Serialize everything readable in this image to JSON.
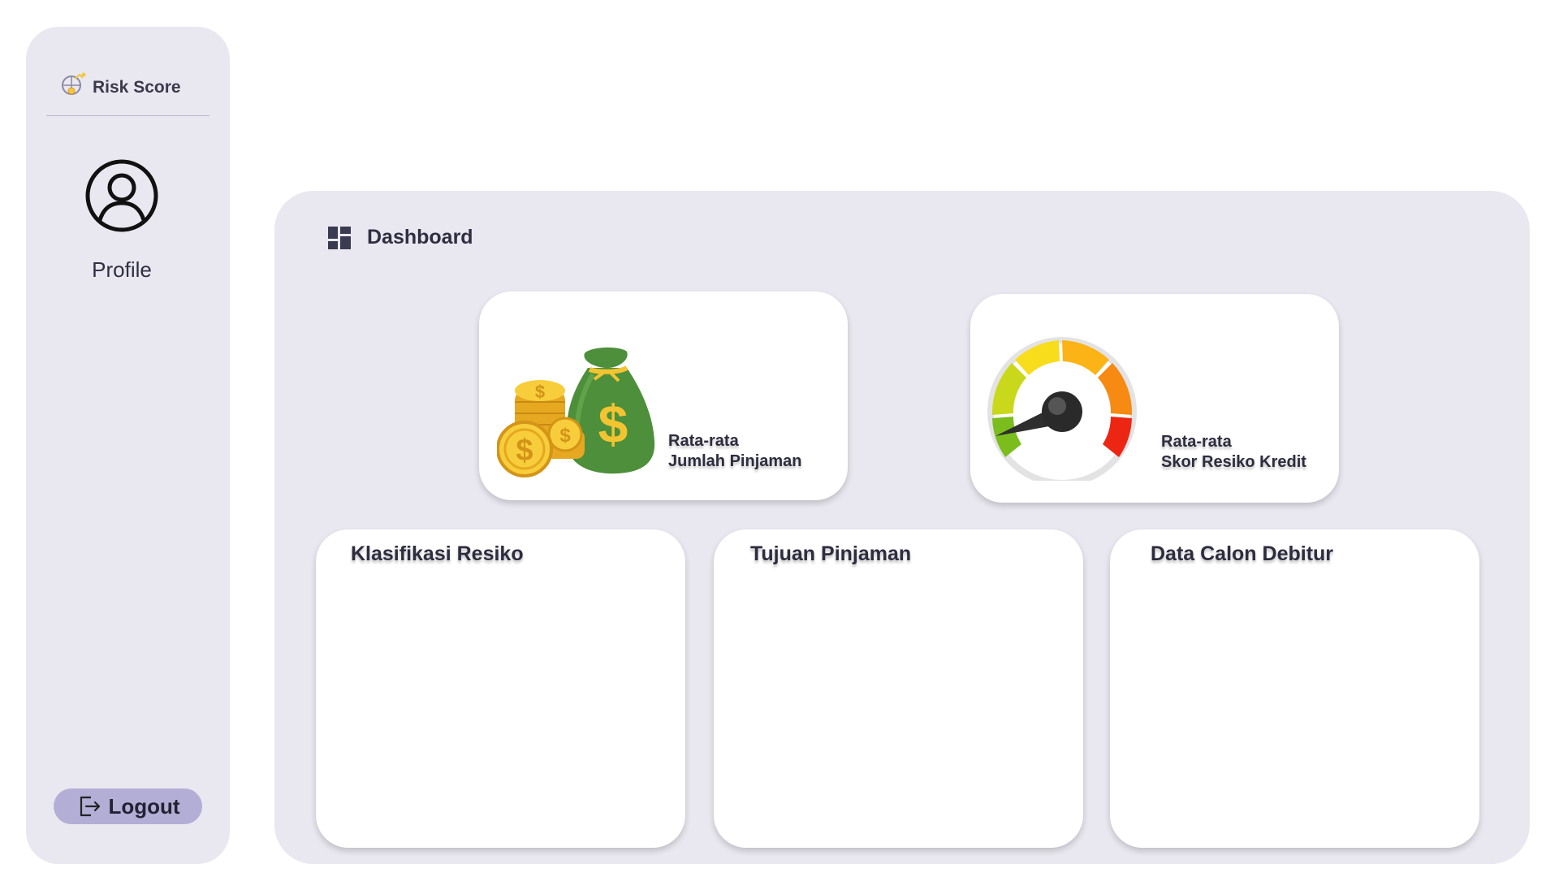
{
  "app": {
    "brand_name": "Risk Score",
    "brand_icon": "risk-score-logo-icon"
  },
  "sidebar": {
    "profile_label": "Profile",
    "profile_icon": "user-circle-icon",
    "logout_label": "Logout",
    "logout_icon": "logout-icon"
  },
  "header": {
    "title": "Dashboard",
    "icon": "dashboard-grid-icon"
  },
  "stats": {
    "loan": {
      "line1": "Rata-rata",
      "line2": "Jumlah Pinjaman",
      "icon": "money-bag-coins-icon"
    },
    "score": {
      "line1": "Rata-rata",
      "line2": "Skor Resiko Kredit",
      "icon": "credit-score-gauge-icon"
    }
  },
  "panels": {
    "risk_classification": "Klasifikasi Resiko",
    "loan_purpose": "Tujuan Pinjaman",
    "debtor_data": "Data Calon Debitur"
  },
  "colors": {
    "panel_bg": "#e9e8f0",
    "card_bg": "#ffffff",
    "logout_bg": "#b3aed6",
    "accent_text": "#2f2f42"
  }
}
